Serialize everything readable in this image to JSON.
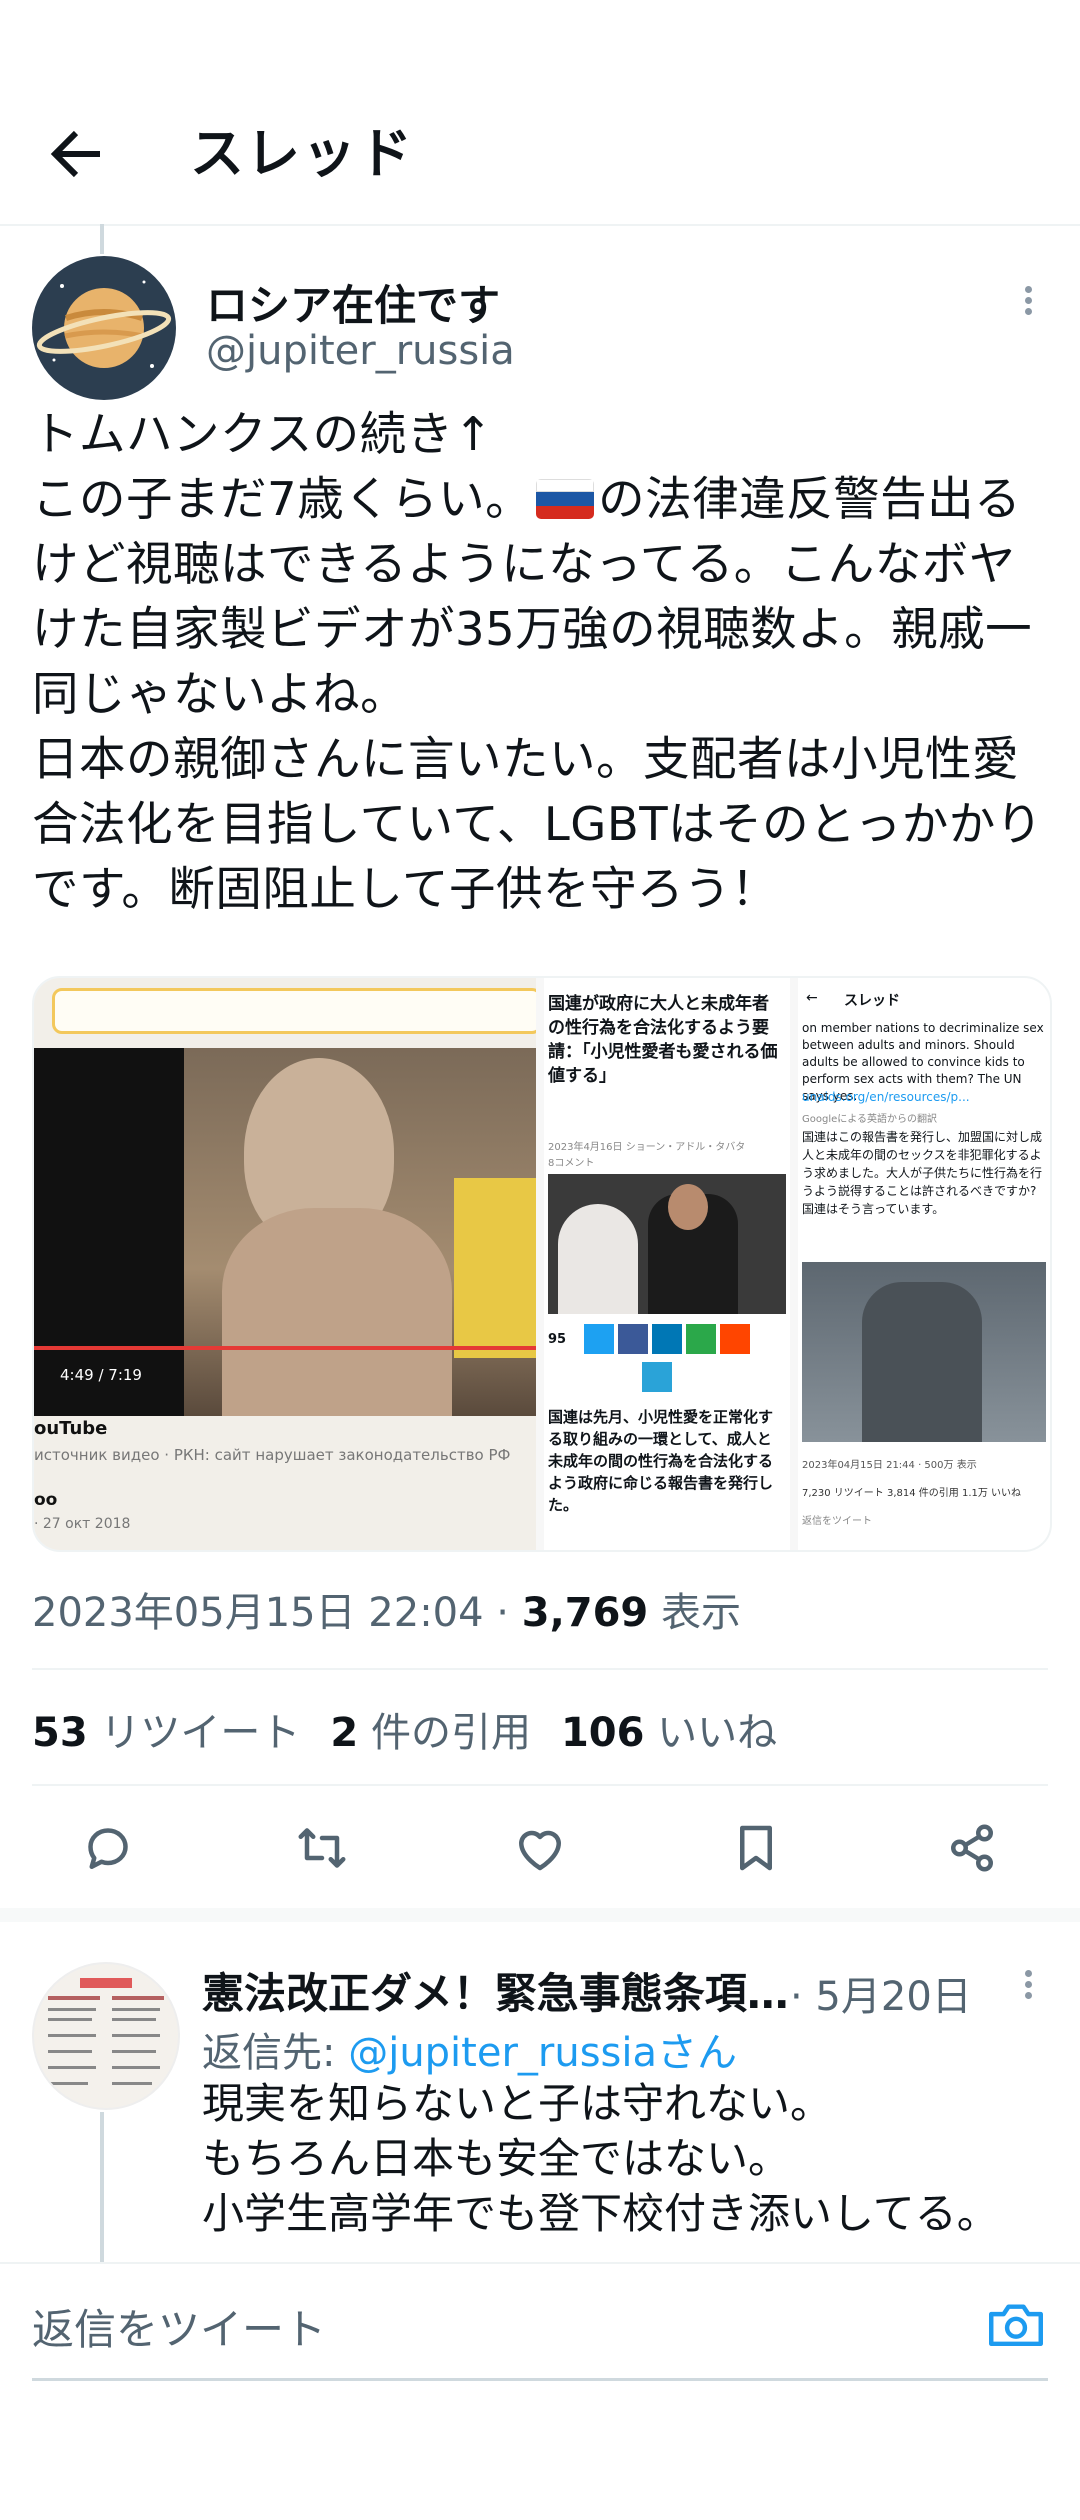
{
  "header": {
    "title": "スレッド",
    "back_icon": "arrow-left-icon"
  },
  "tweet": {
    "display_name": "ロシア在住です",
    "username": "@jupiter_russia",
    "text_before_flag": "トムハンクスの続き↑\nこの子まだ7歳くらい。",
    "flag_icon": "russia-flag-icon",
    "text_after_flag": "の法律違反警告出るけど視聴はできるようになってる。こんなボヤけた自家製ビデオが35万強の視聴数よ。親戚一同じゃないよね。\n日本の親御さんに言いたい。支配者は小児性愛合法化を目指していて、LGBTはそのとっかかりです。断固阻止して子供を守ろう！",
    "media": {
      "video": {
        "timestamp": "4:49 / 7:19",
        "source": "ouTube",
        "warning": "источник видео · РКН: сайт нарушает законодательство РФ",
        "channel": "oo",
        "date": "· 27 окт 2018"
      },
      "article": {
        "headline": "国連が政府に大人と未成年者の性行為を合法化するよう要請：「小児性愛者も愛される価値する」",
        "byline": "2023年4月16日  ショーン・アドル・タバタ",
        "comments": "8コメント",
        "share_count": "95",
        "body": "国連は先月、小児性愛を正常化する取り組みの一環として、成人と未成年の間の性行為を合法化するよう政府に命じる報告書を発行した。"
      },
      "screenshot": {
        "title": "スレッド",
        "english": "on member nations to decriminalize sex between adults and minors. Should adults be allowed to convince kids to perform sex acts with them? The UN says yes.",
        "link": "unaids.org/en/resources/p...",
        "translate": "Googleによる英語からの翻訳",
        "japanese": "国連はこの報告書を発行し、加盟国に対し成人と未成年の間のセックスを非犯罪化するよう求めました。大人が子供たちに性行為を行うよう説得することは許されるべきですか?国連はそう言っています。",
        "date": "2023年04月15日 21:44 · 500万 表示",
        "stats": "7,230 リツイート   3,814 件の引用   1.1万 いいね",
        "reply": "返信をツイート"
      }
    },
    "timestamp": "2023年05月15日 22:04 · ",
    "views_count": "3,769",
    "views_label": " 表示",
    "retweets_count": "53",
    "retweets_label": " リツイート",
    "quotes_count": "2",
    "quotes_label": " 件の引用",
    "likes_count": "106",
    "likes_label": " いいね"
  },
  "actions": [
    "reply-icon",
    "retweet-icon",
    "like-icon",
    "bookmark-icon",
    "share-icon"
  ],
  "reply": {
    "display_name": "憲法改正ダメ！緊急事態条項…",
    "date": "· 5月20日",
    "reply_to_prefix": "返信先: ",
    "reply_to_handle": "@jupiter_russiaさん",
    "text": "現実を知らないと子は守れない。\nもちろん日本も安全ではない。\n小学生高学年でも登下校付き添いしてる。"
  },
  "composer": {
    "placeholder": "返信をツイート",
    "camera_icon": "camera-icon"
  },
  "colors": {
    "accent": "#1d9bf0",
    "secondary": "#536471",
    "border": "#eff3f4"
  }
}
